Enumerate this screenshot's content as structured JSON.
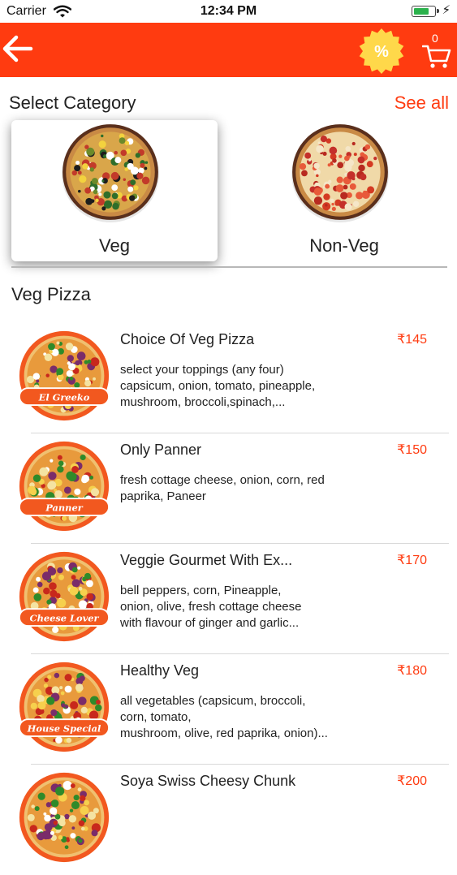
{
  "status_bar": {
    "carrier": "Carrier",
    "time": "12:34 PM",
    "battery_level": 0.75
  },
  "header": {
    "back_icon": "arrow-left-icon",
    "offer_icon": "discount-badge-icon",
    "offer_symbol": "%",
    "cart_count": "0",
    "cart_icon": "cart-icon",
    "background": "#ff3b10",
    "badge_color": "#ffd84a"
  },
  "category_section": {
    "title": "Select Category",
    "see_all": "See all",
    "categories": [
      {
        "label": "Veg",
        "selected": true
      },
      {
        "label": "Non-Veg",
        "selected": false
      }
    ]
  },
  "list": {
    "title": "Veg Pizza",
    "items": [
      {
        "name": "Choice Of Veg Pizza",
        "price": "₹145",
        "description": "select your toppings (any four)\ncapsicum, onion, tomato, pineapple,\n mushroom, broccoli,spinach,...",
        "ribbon": "El Greeko"
      },
      {
        "name": "Only Panner",
        "price": "₹150",
        "description": "fresh cottage cheese, onion, corn, red\npaprika, Paneer",
        "ribbon": "Panner"
      },
      {
        "name": "Veggie Gourmet With Ex...",
        "price": "₹170",
        "description": "bell peppers, corn, Pineapple,\nonion, olive, fresh cottage cheese\nwith flavour of ginger and garlic...",
        "ribbon": "Cheese Lover"
      },
      {
        "name": "Healthy Veg",
        "price": "₹180",
        "description": "all vegetables (capsicum, broccoli,\ncorn, tomato,\nmushroom, olive, red paprika, onion)...",
        "ribbon": "House Special"
      },
      {
        "name": "Soya Swiss Cheesy Chunk",
        "price": "₹200",
        "description": "",
        "ribbon": ""
      }
    ]
  },
  "colors": {
    "accent": "#ff3b10",
    "divider": "#d9d9d9"
  }
}
